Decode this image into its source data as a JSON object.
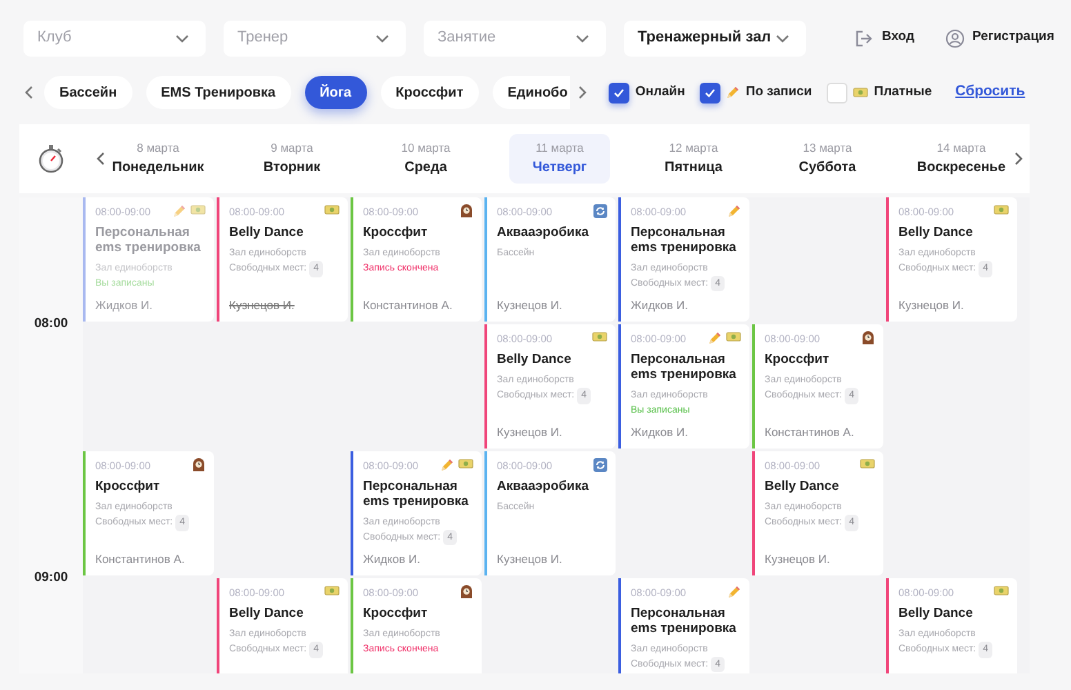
{
  "filters": [
    {
      "placeholder": "Клуб"
    },
    {
      "placeholder": "Тренер"
    },
    {
      "placeholder": "Занятие"
    },
    {
      "value": "Тренажерный зал"
    }
  ],
  "auth": [
    {
      "kind": "login",
      "label": "Вход"
    },
    {
      "kind": "register",
      "label": "Регистрация"
    }
  ],
  "categories": [
    {
      "label": "Бассейн",
      "selected": false
    },
    {
      "label": "EMS Тренировка",
      "selected": false
    },
    {
      "label": "Йога",
      "selected": true
    },
    {
      "label": "Кроссфит",
      "selected": false
    },
    {
      "label": "Единобо",
      "selected": false
    }
  ],
  "options": [
    {
      "label": "Онлайн",
      "checked": true
    },
    {
      "label": "По записи",
      "checked": true,
      "kind": "pencil"
    },
    {
      "label": "Платные",
      "checked": false,
      "kind": "money"
    }
  ],
  "reset": "Сбросить",
  "days": [
    {
      "date": "8 марта",
      "weekday": "Понедельник",
      "selected": false
    },
    {
      "date": "9 марта",
      "weekday": "Вторник",
      "selected": false
    },
    {
      "date": "10 марта",
      "weekday": "Среда",
      "selected": false
    },
    {
      "date": "11 марта",
      "weekday": "Четверг",
      "selected": true
    },
    {
      "date": "12 марта",
      "weekday": "Пятница",
      "selected": false
    },
    {
      "date": "13 марта",
      "weekday": "Суббота",
      "selected": false
    },
    {
      "date": "14 марта",
      "weekday": "Воскресенье",
      "selected": false
    }
  ],
  "hours": [
    {
      "time": "08:00",
      "rows": [
        [
          {
            "kind": "class",
            "faded": true,
            "color": "#a9b9f0",
            "time": "08:00-09:00",
            "icons": [
              {
                "kind": "pencil"
              },
              {
                "kind": "money"
              }
            ],
            "title": "Персональная ems тренировка",
            "room": "Зал единоборств",
            "status": {
              "kind": "booked",
              "text": "Вы записаны"
            },
            "trainer": "Жидков И.",
            "trainer_struck": false
          },
          {
            "kind": "class",
            "faded": false,
            "color": "#f0457a",
            "time": "08:00-09:00",
            "icons": [
              {
                "kind": "money"
              }
            ],
            "title": "Belly Dance",
            "room": "Зал единоборств",
            "free_label": "Свободных мест:",
            "free_count": "4",
            "trainer": "Кузнецов И.",
            "trainer_struck": true
          },
          {
            "kind": "class",
            "faded": false,
            "color": "#6cc644",
            "time": "08:00-09:00",
            "icons": [
              {
                "kind": "clock"
              }
            ],
            "title": "Кроссфит",
            "room": "Зал единоборств",
            "status": {
              "kind": "closed",
              "text": "Запись скончена"
            },
            "trainer": "Константинов А.",
            "trainer_struck": false
          },
          {
            "kind": "class",
            "faded": false,
            "color": "#5bb3f0",
            "time": "08:00-09:00",
            "icons": [
              {
                "kind": "refresh"
              }
            ],
            "title": "Аквааэробика",
            "room": "Бассейн",
            "trainer": "Кузнецов И.",
            "trainer_struck": false
          },
          {
            "kind": "class",
            "faded": false,
            "color": "#3b5ee0",
            "time": "08:00-09:00",
            "icons": [
              {
                "kind": "pencil"
              }
            ],
            "title": "Персональная ems тренировка",
            "room": "Зал единоборств",
            "free_label": "Свободных мест:",
            "free_count": "4",
            "trainer": "Жидков И.",
            "trainer_struck": false
          },
          {
            "kind": "empty"
          },
          {
            "kind": "class",
            "faded": false,
            "color": "#f0457a",
            "time": "08:00-09:00",
            "icons": [
              {
                "kind": "money"
              }
            ],
            "title": "Belly Dance",
            "room": "Зал единоборств",
            "free_label": "Свободных мест:",
            "free_count": "4",
            "trainer": "Кузнецов И.",
            "trainer_struck": false
          }
        ],
        [
          {
            "kind": "empty"
          },
          {
            "kind": "empty"
          },
          {
            "kind": "empty"
          },
          {
            "kind": "class",
            "faded": false,
            "color": "#f0457a",
            "time": "08:00-09:00",
            "icons": [
              {
                "kind": "money"
              }
            ],
            "title": "Belly Dance",
            "room": "Зал единоборств",
            "free_label": "Свободных мест:",
            "free_count": "4",
            "trainer": "Кузнецов И.",
            "trainer_struck": false
          },
          {
            "kind": "class",
            "faded": false,
            "color": "#3b5ee0",
            "time": "08:00-09:00",
            "icons": [
              {
                "kind": "pencil"
              },
              {
                "kind": "money"
              }
            ],
            "title": "Персональная ems тренировка",
            "room": "Зал единоборств",
            "status": {
              "kind": "booked",
              "text": "Вы записаны"
            },
            "trainer": "Жидков И.",
            "trainer_struck": false
          },
          {
            "kind": "class",
            "faded": false,
            "color": "#6cc644",
            "time": "08:00-09:00",
            "icons": [
              {
                "kind": "clock"
              }
            ],
            "title": "Кроссфит",
            "room": "Зал единоборств",
            "free_label": "Свободных мест:",
            "free_count": "4",
            "trainer": "Константинов А.",
            "trainer_struck": false
          },
          {
            "kind": "empty"
          }
        ]
      ]
    },
    {
      "time": "09:00",
      "rows": [
        [
          {
            "kind": "class",
            "faded": false,
            "color": "#6cc644",
            "time": "08:00-09:00",
            "icons": [
              {
                "kind": "clock"
              }
            ],
            "title": "Кроссфит",
            "room": "Зал единоборств",
            "free_label": "Свободных мест:",
            "free_count": "4",
            "trainer": "Константинов А.",
            "trainer_struck": false
          },
          {
            "kind": "empty"
          },
          {
            "kind": "class",
            "faded": false,
            "color": "#3b5ee0",
            "time": "08:00-09:00",
            "icons": [
              {
                "kind": "pencil"
              },
              {
                "kind": "money"
              }
            ],
            "title": "Персональная ems тренировка",
            "room": "Зал единоборств",
            "free_label": "Свободных мест:",
            "free_count": "4",
            "trainer": "Жидков И.",
            "trainer_struck": false
          },
          {
            "kind": "class",
            "faded": false,
            "color": "#5bb3f0",
            "time": "08:00-09:00",
            "icons": [
              {
                "kind": "refresh"
              }
            ],
            "title": "Аквааэробика",
            "room": "Бассейн",
            "trainer": "Кузнецов И.",
            "trainer_struck": false
          },
          {
            "kind": "empty"
          },
          {
            "kind": "class",
            "faded": false,
            "color": "#f0457a",
            "time": "08:00-09:00",
            "icons": [
              {
                "kind": "money"
              }
            ],
            "title": "Belly Dance",
            "room": "Зал единоборств",
            "free_label": "Свободных мест:",
            "free_count": "4",
            "trainer": "Кузнецов И.",
            "trainer_struck": false
          },
          {
            "kind": "empty"
          }
        ],
        [
          {
            "kind": "empty"
          },
          {
            "kind": "class",
            "faded": false,
            "color": "#f0457a",
            "time": "08:00-09:00",
            "icons": [
              {
                "kind": "money"
              }
            ],
            "title": "Belly Dance",
            "room": "Зал единоборств",
            "free_label": "Свободных мест:",
            "free_count": "4"
          },
          {
            "kind": "class",
            "faded": false,
            "color": "#6cc644",
            "time": "08:00-09:00",
            "icons": [
              {
                "kind": "clock"
              }
            ],
            "title": "Кроссфит",
            "room": "Зал единоборств",
            "status": {
              "kind": "closed",
              "text": "Запись скончена"
            }
          },
          {
            "kind": "empty"
          },
          {
            "kind": "class",
            "faded": false,
            "color": "#3b5ee0",
            "time": "08:00-09:00",
            "icons": [
              {
                "kind": "pencil"
              }
            ],
            "title": "Персональная ems тренировка",
            "room": "Зал единоборств",
            "free_label": "Свободных мест:",
            "free_count": "4"
          },
          {
            "kind": "empty"
          },
          {
            "kind": "class",
            "faded": false,
            "color": "#f0457a",
            "time": "08:00-09:00",
            "icons": [
              {
                "kind": "money"
              }
            ],
            "title": "Belly Dance",
            "room": "Зал единоборств",
            "free_label": "Свободных мест:",
            "free_count": "4"
          }
        ]
      ]
    }
  ]
}
